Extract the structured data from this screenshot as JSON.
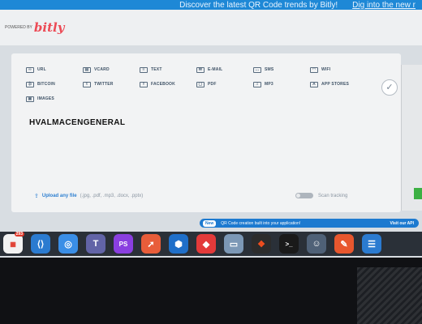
{
  "promo": {
    "text": "Discover the latest QR Code trends by Bitly!",
    "link": "Dig into the new r"
  },
  "header": {
    "powered_by": "POWERED BY",
    "logo": "bitly"
  },
  "qr_types": [
    [
      {
        "label": "URL",
        "icon": "link-icon"
      },
      {
        "label": "VCARD",
        "icon": "vcard-icon"
      },
      {
        "label": "TEXT",
        "icon": "text-icon"
      },
      {
        "label": "E-MAIL",
        "icon": "mail-icon"
      },
      {
        "label": "SMS",
        "icon": "sms-icon"
      },
      {
        "label": "WIFI",
        "icon": "wifi-icon"
      }
    ],
    [
      {
        "label": "BITCOIN",
        "icon": "bitcoin-icon"
      },
      {
        "label": "TWITTER",
        "icon": "twitter-icon"
      },
      {
        "label": "FACEBOOK",
        "icon": "facebook-icon"
      },
      {
        "label": "PDF",
        "icon": "pdf-icon"
      },
      {
        "label": "MP3",
        "icon": "music-icon"
      },
      {
        "label": "APP STORES",
        "icon": "app-store-icon"
      }
    ],
    [
      {
        "label": "IMAGES",
        "icon": "image-icon"
      }
    ]
  ],
  "content_value": "HVALMACENGENERAL",
  "upload": {
    "link": "Upload any file",
    "hint": "(.jpg, .pdf, .mp3, .docx, .pptx)"
  },
  "scan_tracking": {
    "label": "Scan tracking",
    "enabled": false
  },
  "api_banner": {
    "badge": "New",
    "text": "QR Code creation built into your application!",
    "cta": "Visit our API"
  },
  "dock": [
    {
      "name": "calendar",
      "icon": "calendar-icon",
      "color": "#f2f2f2",
      "badge": "293"
    },
    {
      "name": "vscode",
      "icon": "vscode-icon",
      "color": "#2b7bd0"
    },
    {
      "name": "safari",
      "icon": "safari-icon",
      "color": "#3a8ee6"
    },
    {
      "name": "teams",
      "icon": "teams-icon",
      "color": "#6264a7"
    },
    {
      "name": "phpstorm",
      "icon": "phpstorm-icon",
      "color": "#8a3fe0"
    },
    {
      "name": "postman",
      "icon": "postman-icon",
      "color": "#e85d3a"
    },
    {
      "name": "sourcetree",
      "icon": "sourcetree-icon",
      "color": "#1f6fc9"
    },
    {
      "name": "anydesk",
      "icon": "anydesk-icon",
      "color": "#e33a3a"
    },
    {
      "name": "preview",
      "icon": "preview-icon",
      "color": "#7c98b6"
    },
    {
      "name": "figma",
      "icon": "figma-icon",
      "color": "#2c2c2c"
    },
    {
      "name": "terminal",
      "icon": "terminal-icon",
      "color": "#1a1a1a"
    },
    {
      "name": "finder",
      "icon": "finder-icon",
      "color": "#4f6177"
    },
    {
      "name": "pencil",
      "icon": "pencil-icon",
      "color": "#e8572e"
    },
    {
      "name": "database",
      "icon": "database-icon",
      "color": "#2b7bd0"
    }
  ]
}
